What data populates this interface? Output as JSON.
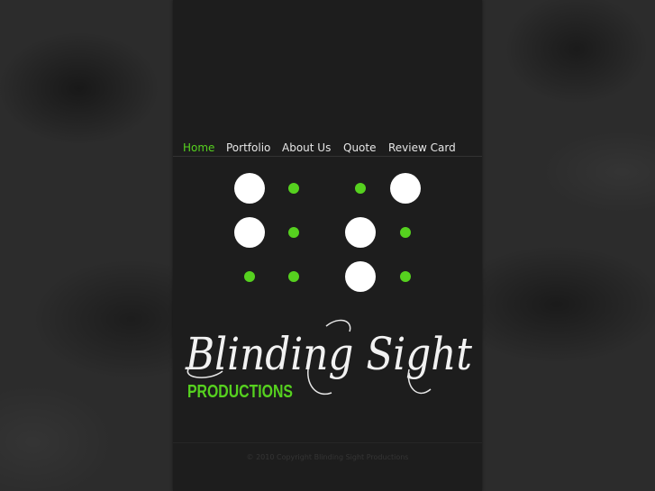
{
  "nav": {
    "items": [
      {
        "label": "Home",
        "active": true
      },
      {
        "label": "Portfolio",
        "active": false
      },
      {
        "label": "About Us",
        "active": false
      },
      {
        "label": "Quote",
        "active": false
      },
      {
        "label": "Review Card",
        "active": false
      }
    ]
  },
  "logo": {
    "script_text": "Blinding Sight",
    "subtitle": "PRODUCTIONS"
  },
  "footer": {
    "copyright": "© 2010 Copyright Blinding Sight Productions"
  },
  "colors": {
    "accent_green": "#56d11f",
    "nav_text": "#e6e6e6",
    "panel_bg": "#1d1d1d",
    "page_bg": "#2c2c2c"
  }
}
